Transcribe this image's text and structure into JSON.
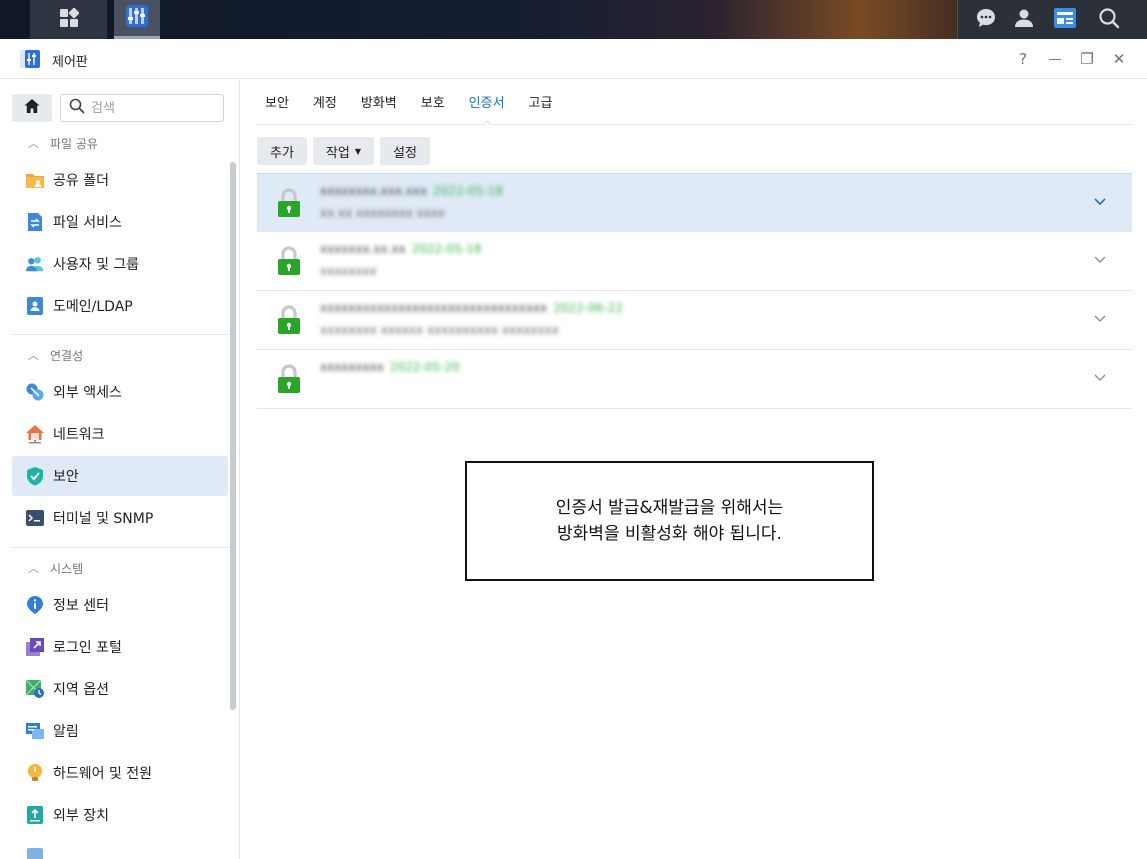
{
  "taskbar": {
    "left_icons": [
      "grid-icon",
      "control-panel-app-icon"
    ],
    "right_icons": [
      "chat-icon",
      "user-icon",
      "widgets-icon",
      "search-icon"
    ]
  },
  "window": {
    "title": "제어판",
    "controls": {
      "help": "?",
      "minimize": "—",
      "restore": "❐",
      "close": "✕"
    }
  },
  "sidebar": {
    "search_placeholder": "검색",
    "sections": [
      {
        "title": "파일 공유",
        "items": [
          {
            "label": "공유 폴더",
            "icon": "shared-folder-icon"
          },
          {
            "label": "파일 서비스",
            "icon": "file-services-icon"
          },
          {
            "label": "사용자 및 그룹",
            "icon": "users-groups-icon"
          },
          {
            "label": "도메인/LDAP",
            "icon": "domain-ldap-icon"
          }
        ]
      },
      {
        "title": "연결성",
        "items": [
          {
            "label": "외부 액세스",
            "icon": "external-access-icon"
          },
          {
            "label": "네트워크",
            "icon": "network-icon"
          },
          {
            "label": "보안",
            "icon": "security-shield-icon",
            "active": true
          },
          {
            "label": "터미널 및 SNMP",
            "icon": "terminal-icon"
          }
        ]
      },
      {
        "title": "시스템",
        "items": [
          {
            "label": "정보 센터",
            "icon": "info-center-icon"
          },
          {
            "label": "로그인 포털",
            "icon": "login-portal-icon"
          },
          {
            "label": "지역 옵션",
            "icon": "regional-options-icon"
          },
          {
            "label": "알림",
            "icon": "notification-icon"
          },
          {
            "label": "하드웨어 및 전원",
            "icon": "hardware-power-icon"
          },
          {
            "label": "외부 장치",
            "icon": "external-devices-icon"
          }
        ]
      }
    ]
  },
  "main": {
    "tabs": [
      {
        "label": "보안"
      },
      {
        "label": "계정"
      },
      {
        "label": "방화벽"
      },
      {
        "label": "보호"
      },
      {
        "label": "인증서",
        "active": true
      },
      {
        "label": "고급"
      }
    ],
    "toolbar": {
      "add": "추가",
      "action": "작업",
      "settings": "설정"
    },
    "certificates": [
      {
        "name": "xxxxxxxx.xxx.xxx",
        "date": "2022-05-18",
        "sub": "xx xx xxxxxxxx xxxx",
        "selected": true
      },
      {
        "name": "xxxxxxx.xx.xx",
        "date": "2022-05-18",
        "sub": "xxxxxxxx"
      },
      {
        "name": "xxxxxxxxxxxxxxxxxxxxxxxxxxxxxxxx",
        "date": "2022-06-22",
        "sub": "xxxxxxxx xxxxxx xxxxxxxxxx xxxxxxxx"
      },
      {
        "name": "xxxxxxxxx",
        "date": "2022-05-20",
        "sub": ""
      }
    ],
    "notice": {
      "line1": "인증서 발급&재발급을 위해서는",
      "line2": "방화벽을 비활성화 해야 됩니다."
    }
  },
  "colors": {
    "accent": "#1673c5",
    "active_bg": "#dfeaf6",
    "lock_green": "#2aa52a",
    "expiry_green": "#3fb44e"
  }
}
